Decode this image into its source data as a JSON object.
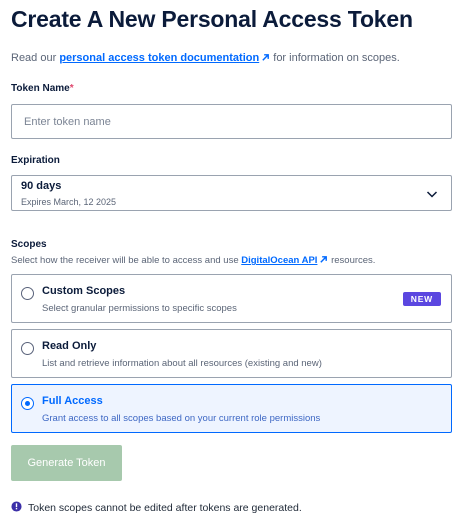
{
  "page": {
    "title": "Create A New Personal Access Token"
  },
  "intro": {
    "prefix": "Read our ",
    "link_text": "personal access token documentation",
    "suffix": " for information on scopes."
  },
  "token_name": {
    "label": "Token Name",
    "required_mark": "*",
    "placeholder": "Enter token name",
    "value": ""
  },
  "expiration": {
    "label": "Expiration",
    "selected_value": "90 days",
    "expires_text": "Expires March, 12 2025"
  },
  "scopes": {
    "label": "Scopes",
    "subtitle_prefix": "Select how the receiver will be able to access and use ",
    "subtitle_link": "DigitalOcean API",
    "subtitle_suffix": " resources.",
    "options": [
      {
        "title": "Custom Scopes",
        "description": "Select granular permissions to specific scopes",
        "badge": "NEW",
        "selected": false
      },
      {
        "title": "Read Only",
        "description": "List and retrieve information about all resources (existing and new)",
        "selected": false
      },
      {
        "title": "Full Access",
        "description": "Grant access to all scopes based on your current role permissions",
        "selected": true
      }
    ]
  },
  "actions": {
    "generate_label": "Generate Token"
  },
  "note": {
    "text": "Token scopes cannot be edited after tokens are generated."
  },
  "colors": {
    "accent": "#0069ff",
    "badge": "#5b47e0",
    "button_disabled": "#a7c9ad",
    "heading": "#0b1b3a"
  },
  "icons": {
    "external_link": "external-link-icon",
    "chevron": "chevron-down-icon",
    "info": "info-icon"
  }
}
